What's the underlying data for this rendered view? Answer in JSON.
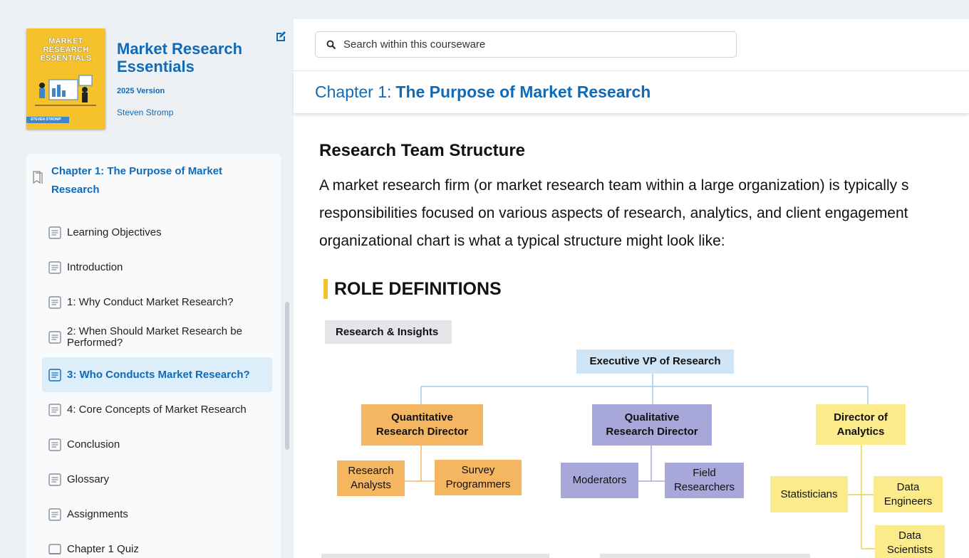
{
  "book": {
    "cover_title": "MARKET\nRESEARCH\nESSENTIALS",
    "cover_author": "STEVEN STROMP",
    "title": "Market Research Essentials",
    "version": "2025 Version",
    "author": "Steven Stromp"
  },
  "toc": {
    "chapter": "Chapter 1: The Purpose of Market Research",
    "items": [
      {
        "label": "Learning Objectives",
        "icon": "page-icon"
      },
      {
        "label": "Introduction",
        "icon": "page-icon"
      },
      {
        "label": "1: Why Conduct Market Research?",
        "icon": "page-icon"
      },
      {
        "label": "2: When Should Market Research be Performed?",
        "icon": "page-icon"
      },
      {
        "label": "3: Who Conducts Market Research?",
        "icon": "page-icon",
        "active": true
      },
      {
        "label": "4: Core Concepts of Market Research",
        "icon": "page-icon"
      },
      {
        "label": "Conclusion",
        "icon": "page-icon"
      },
      {
        "label": "Glossary",
        "icon": "page-icon"
      },
      {
        "label": "Assignments",
        "icon": "page-icon"
      },
      {
        "label": "Chapter 1 Quiz",
        "icon": "quiz-icon"
      }
    ]
  },
  "search": {
    "placeholder": "Search within this courseware"
  },
  "header": {
    "chapter_prefix": "Chapter 1:",
    "chapter_title": "The Purpose of Market Research"
  },
  "content": {
    "section_title": "Research Team Structure",
    "para_lines": [
      "A market research firm (or market research team within a large organization) is typically s",
      "responsibilities focused on various aspects of research, analytics, and client engagement",
      "organizational chart is what a typical structure might look like:"
    ],
    "role_definitions": "ROLE DEFINITIONS"
  },
  "org_chart": {
    "tag": "Research & Insights",
    "executive": "Executive VP of Research",
    "quant_director": "Quantitative\nResearch Director",
    "qual_director": "Qualitative\nResearch Director",
    "analytics_director": "Director of\nAnalytics",
    "research_analysts": "Research\nAnalysts",
    "survey_programmers": "Survey\nProgrammers",
    "moderators": "Moderators",
    "field_researchers": "Field\nResearchers",
    "statisticians": "Statisticians",
    "data_engineers": "Data\nEngineers",
    "data_scientists": "Data\nScientists"
  },
  "colors": {
    "accent": "#0f6ab8",
    "orange": "#f5b662",
    "purple": "#a7a8d9",
    "yellow": "#fbeb8a",
    "blue": "#cfe5f6",
    "highlight": "#f5c22c"
  }
}
